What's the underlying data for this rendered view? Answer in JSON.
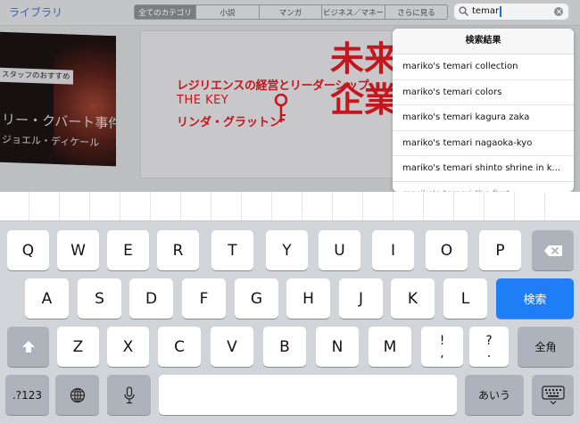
{
  "navbar": {
    "library_label": "ライブラリ",
    "segments": [
      "全てのカテゴリ",
      "小説",
      "マンガ",
      "ビジネス／マネー",
      "さらに見る"
    ],
    "search": {
      "value": "temari"
    }
  },
  "banners": {
    "left": {
      "badge": "スタッフのおすすめ",
      "title": "リー・クバート事件",
      "author": "ジョエル・ディケール"
    },
    "center": {
      "line1": "レジリエンスの経営とリーダーシップ",
      "line2": "THE KEY",
      "line3": "リンダ・グラットン",
      "big1": "未来",
      "big2": "企業"
    }
  },
  "suggestions": {
    "header": "検索結果",
    "items": [
      "mariko's temari collection",
      "mariko's temari colors",
      "mariko's temari kagura zaka",
      "mariko's temari nagaoka-kyo",
      "mariko's temari shinto shrine in k...",
      "mariko's temari the first"
    ]
  },
  "keyboard": {
    "row1": [
      "Q",
      "W",
      "E",
      "R",
      "T",
      "Y",
      "U",
      "I",
      "O",
      "P"
    ],
    "row2": [
      "A",
      "S",
      "D",
      "F",
      "G",
      "H",
      "J",
      "K",
      "L"
    ],
    "search_key": "検索",
    "row3": [
      "Z",
      "X",
      "C",
      "V",
      "B",
      "N",
      "M"
    ],
    "excl_top": "!",
    "excl_bottom": ",",
    "q_top": "?",
    "q_bottom": ".",
    "fullwidth": "全角",
    "numbers": ".?123",
    "kana": "あいう"
  },
  "colors": {
    "accent": "#1f7ef6",
    "link": "#3a63a6",
    "banner_red": "#c4161c"
  }
}
